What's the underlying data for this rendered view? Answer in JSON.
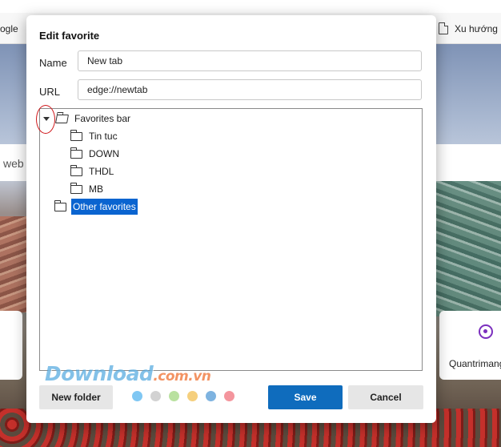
{
  "background": {
    "bookmarks_left": "ogle",
    "bookmarks_right": "Xu hướng",
    "search_text": "web",
    "card_label": "Quantrimang",
    "watermark_main": "Download",
    "watermark_sub": ".com.vn"
  },
  "dialog": {
    "title": "Edit favorite",
    "name_label": "Name",
    "name_value": "New tab",
    "url_label": "URL",
    "url_value": "edge://newtab",
    "tree": {
      "root": "Favorites bar",
      "children": [
        "Tin tuc",
        "DOWN",
        "THDL",
        "MB"
      ],
      "other": "Other favorites",
      "selected": "Other favorites"
    },
    "new_folder_label": "New folder",
    "save_label": "Save",
    "cancel_label": "Cancel",
    "color_dots": [
      "#7fc7f3",
      "#d2d2d2",
      "#b9e1a0",
      "#f5cf7d",
      "#7eb3e0",
      "#f4959d"
    ]
  },
  "colors": {
    "accent": "#0f6cbd",
    "selection": "#0a64d0",
    "annotation": "#d0181b"
  }
}
